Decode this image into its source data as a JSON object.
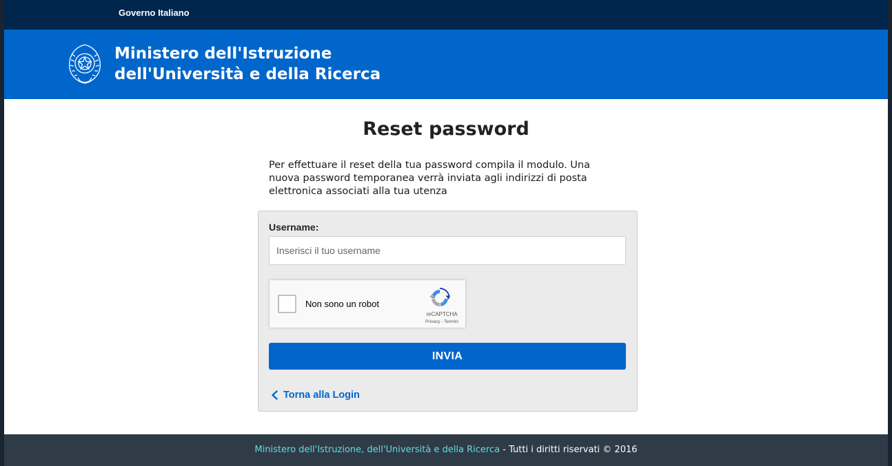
{
  "gov_bar": {
    "label": "Governo Italiano"
  },
  "header": {
    "title_line1": "Ministero dell'Istruzione",
    "title_line2": "dell'Università e della Ricerca",
    "emblem_icon": "italian-republic-emblem-icon"
  },
  "page": {
    "title": "Reset password",
    "intro": "Per effettuare il reset della tua password compila il modulo. Una nuova password temporanea verrà inviata agli indirizzi di posta elettronica associati alla tua utenza"
  },
  "form": {
    "username_label": "Username:",
    "username_value": "",
    "username_placeholder": "Inserisci il tuo username",
    "recaptcha": {
      "label": "Non sono un robot",
      "brand": "reCAPTCHA",
      "privacy": "Privacy",
      "separator": " - ",
      "terms": "Termini",
      "checked": false
    },
    "submit_label": "INVIA",
    "back_label": "Torna alla Login"
  },
  "footer": {
    "link": "Ministero dell'Istruzione, dell'Università e della Ricerca",
    "rest": " - Tutti i diritti riservati © 2016"
  },
  "colors": {
    "gov_bar": "#00264d",
    "brand_blue": "#0066cc",
    "footer_bg": "#2f3b47",
    "footer_link": "#65dcdf",
    "panel_bg": "#ebebeb"
  }
}
